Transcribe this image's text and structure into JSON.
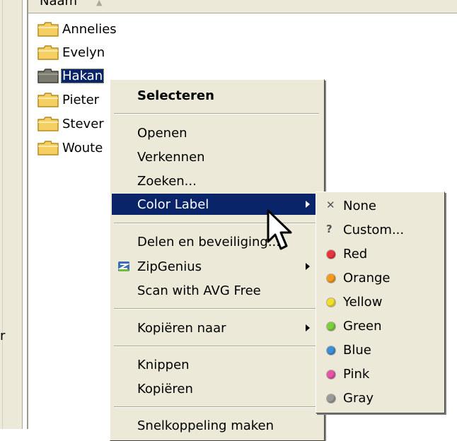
{
  "header": {
    "column_label": "Naam"
  },
  "left_char": "r",
  "folders": [
    {
      "name": "Annelies",
      "selected": false
    },
    {
      "name": "Evelyn",
      "selected": false
    },
    {
      "name": "Hakan",
      "selected": true
    },
    {
      "name": "Pieter",
      "selected": false
    },
    {
      "name": "Stever",
      "selected": false
    },
    {
      "name": "Woute",
      "selected": false
    }
  ],
  "context_menu": {
    "select": "Selecteren",
    "open": "Openen",
    "explore": "Verkennen",
    "search": "Zoeken...",
    "color_label": "Color Label",
    "share": "Delen en beveiliging...",
    "zipgenius": "ZipGenius",
    "scan": "Scan with AVG Free",
    "copy_to": "Kopiëren naar",
    "cut": "Knippen",
    "copy": "Kopiëren",
    "shortcut": "Snelkoppeling maken"
  },
  "color_submenu": {
    "items": [
      {
        "label": "None",
        "glyph": "✕"
      },
      {
        "label": "Custom...",
        "glyph": "?"
      },
      {
        "label": "Red",
        "color": "#e8343f"
      },
      {
        "label": "Orange",
        "color": "#f59a1d"
      },
      {
        "label": "Yellow",
        "color": "#f1df2b"
      },
      {
        "label": "Green",
        "color": "#7ccf3c"
      },
      {
        "label": "Blue",
        "color": "#3c8fd6"
      },
      {
        "label": "Pink",
        "color": "#e654a8"
      },
      {
        "label": "Gray",
        "color": "#9a9a9a"
      }
    ]
  },
  "icons": {
    "folder": "folder-icon",
    "zipgenius": "zipgenius-icon",
    "cursor": "mouse-pointer-icon"
  }
}
